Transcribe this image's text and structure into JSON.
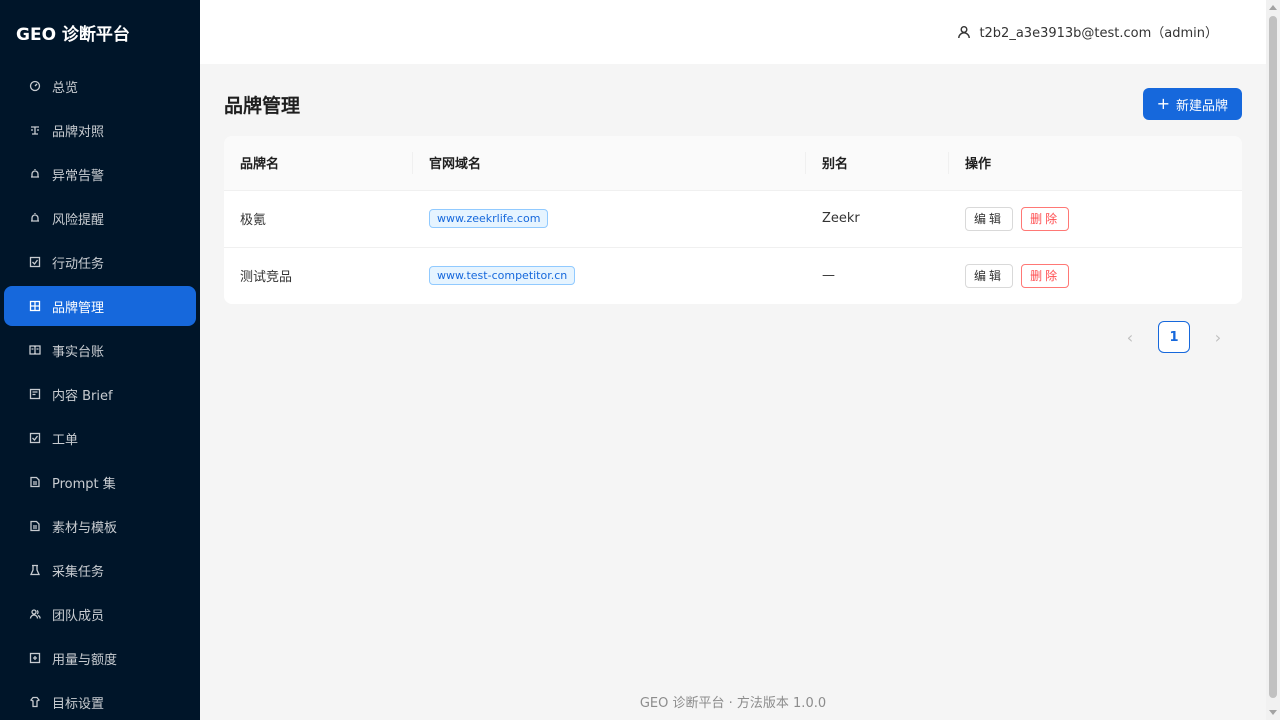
{
  "app": {
    "title": "GEO 诊断平台"
  },
  "sidebar": {
    "items": [
      {
        "label": "总览",
        "icon": "dashboard-icon",
        "active": false
      },
      {
        "label": "品牌对照",
        "icon": "compare-icon",
        "active": false
      },
      {
        "label": "异常告警",
        "icon": "alert-icon",
        "active": false
      },
      {
        "label": "风险提醒",
        "icon": "risk-icon",
        "active": false
      },
      {
        "label": "行动任务",
        "icon": "task-icon",
        "active": false
      },
      {
        "label": "品牌管理",
        "icon": "brand-icon",
        "active": true
      },
      {
        "label": "事实台账",
        "icon": "ledger-icon",
        "active": false
      },
      {
        "label": "内容 Brief",
        "icon": "brief-icon",
        "active": false
      },
      {
        "label": "工单",
        "icon": "ticket-icon",
        "active": false
      },
      {
        "label": "Prompt 集",
        "icon": "prompt-icon",
        "active": false
      },
      {
        "label": "素材与模板",
        "icon": "template-icon",
        "active": false
      },
      {
        "label": "采集任务",
        "icon": "collect-icon",
        "active": false
      },
      {
        "label": "团队成员",
        "icon": "team-icon",
        "active": false
      },
      {
        "label": "用量与额度",
        "icon": "usage-icon",
        "active": false
      },
      {
        "label": "目标设置",
        "icon": "target-icon",
        "active": false
      }
    ]
  },
  "header": {
    "user": "t2b2_a3e3913b@test.com（admin）"
  },
  "main": {
    "title": "品牌管理",
    "new_button": "新建品牌",
    "columns": [
      "品牌名",
      "官网域名",
      "别名",
      "操作"
    ],
    "rows": [
      {
        "name": "极氪",
        "domain": "www.zeekrlife.com",
        "alias": "Zeekr",
        "edit": "编辑",
        "delete": "删除"
      },
      {
        "name": "测试竞品",
        "domain": "www.test-competitor.cn",
        "alias": "—",
        "edit": "编辑",
        "delete": "删除"
      }
    ],
    "pagination": {
      "current": "1"
    }
  },
  "footer": {
    "text": "GEO 诊断平台 · 方法版本 1.0.0"
  },
  "colors": {
    "sidebar_bg": "#001529",
    "primary": "#1668dc",
    "danger": "#ff4d4f"
  }
}
